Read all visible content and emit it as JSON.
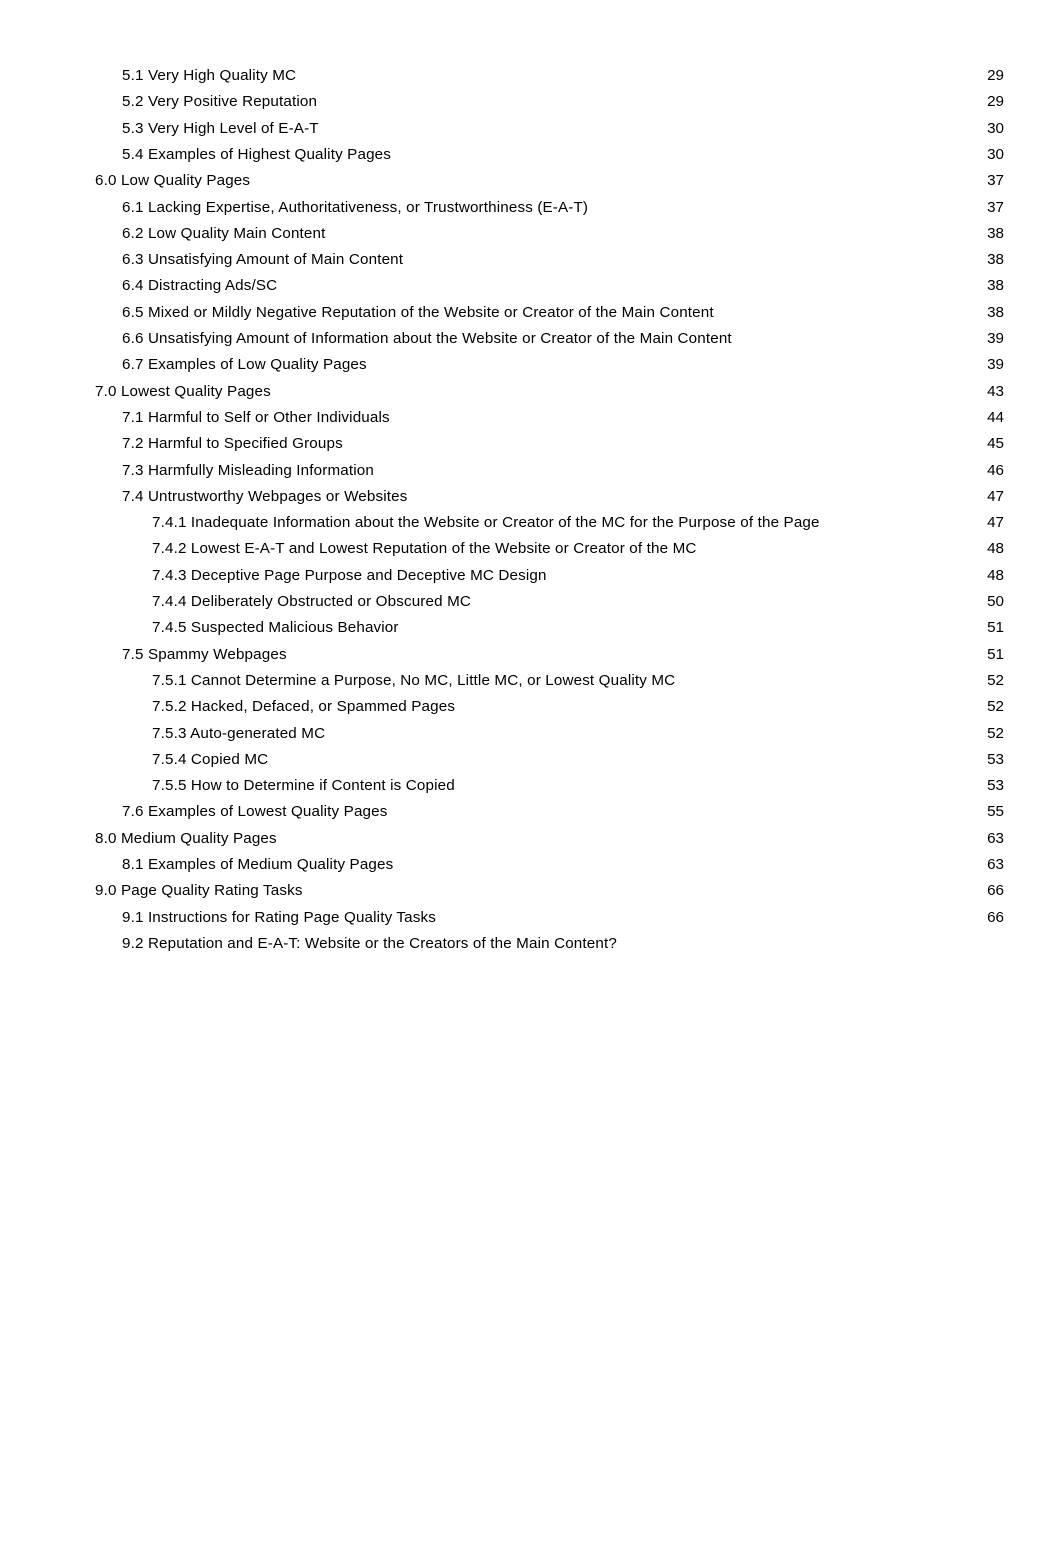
{
  "document": {
    "type": "table-of-contents",
    "page_background": "#ffffff",
    "text_color": "#000000"
  },
  "toc": {
    "entries": [
      {
        "label": "5.1 Very High Quality MC",
        "page": "29",
        "level": 2,
        "blur": 0
      },
      {
        "label": "5.2 Very Positive Reputation",
        "page": "29",
        "level": 2,
        "blur": 0
      },
      {
        "label": "5.3 Very High Level of E-A-T",
        "page": "30",
        "level": 2,
        "blur": 0
      },
      {
        "label": "5.4 Examples of Highest Quality Pages",
        "page": "30",
        "level": 2,
        "blur": 0
      },
      {
        "label": "6.0 Low Quality Pages",
        "page": "37",
        "level": 1,
        "blur": 0
      },
      {
        "label": "6.1 Lacking Expertise, Authoritativeness, or Trustworthiness (E-A-T)",
        "page": "37",
        "level": 2,
        "blur": 0
      },
      {
        "label": "6.2 Low Quality Main Content",
        "page": "38",
        "level": 2,
        "blur": 0
      },
      {
        "label": "6.3 Unsatisfying Amount of Main Content",
        "page": "38",
        "level": 2,
        "blur": 0
      },
      {
        "label": "6.4 Distracting Ads/SC",
        "page": "38",
        "level": 2,
        "blur": 0
      },
      {
        "label": "6.5 Mixed or Mildly Negative Reputation of the Website or Creator of the Main Content",
        "page": "38",
        "level": 2,
        "blur": 0
      },
      {
        "label": "6.6 Unsatisfying Amount of Information about the Website or Creator of the Main Content",
        "page": "39",
        "level": 2,
        "blur": 0
      },
      {
        "label": "6.7 Examples of Low Quality Pages",
        "page": "39",
        "level": 2,
        "blur": 0
      },
      {
        "label": "7.0 Lowest Quality Pages",
        "page": "43",
        "level": 1,
        "blur": 0
      },
      {
        "label": "7.1 Harmful to Self or Other Individuals",
        "page": "44",
        "level": 2,
        "blur": 0
      },
      {
        "label": "7.2 Harmful to Specified Groups",
        "page": "45",
        "level": 2,
        "blur": 0
      },
      {
        "label": "7.3 Harmfully Misleading Information",
        "page": "46",
        "level": 2,
        "blur": 0
      },
      {
        "label": "7.4 Untrustworthy Webpages or Websites",
        "page": "47",
        "level": 2,
        "blur": 0
      },
      {
        "label": "7.4.1 Inadequate Information about the Website or Creator of the MC for the Purpose of the Page",
        "page": "47",
        "level": 3,
        "blur": 0
      },
      {
        "label": "7.4.2 Lowest E-A-T and Lowest Reputation of the Website or Creator of the MC",
        "page": "48",
        "level": 3,
        "blur": 0
      },
      {
        "label": "7.4.3 Deceptive Page Purpose and Deceptive MC Design",
        "page": "48",
        "level": 3,
        "blur": 0
      },
      {
        "label": "7.4.4 Deliberately Obstructed or Obscured MC",
        "page": "50",
        "level": 3,
        "blur": 0
      },
      {
        "label": "7.4.5 Suspected Malicious Behavior",
        "page": "51",
        "level": 3,
        "blur": 0
      },
      {
        "label": "7.5 Spammy Webpages",
        "page": "51",
        "level": 2,
        "blur": 0
      },
      {
        "label": "7.5.1 Cannot Determine a Purpose, No MC, Little MC, or Lowest Quality MC",
        "page": "52",
        "level": 3,
        "blur": 0
      },
      {
        "label": "7.5.2 Hacked, Defaced, or Spammed Pages",
        "page": "52",
        "level": 3,
        "blur": 0
      },
      {
        "label": "7.5.3 Auto-generated MC",
        "page": "52",
        "level": 3,
        "blur": 0
      },
      {
        "label": "7.5.4 Copied MC",
        "page": "53",
        "level": 3,
        "blur": 0
      },
      {
        "label": "7.5.5 How to Determine if Content is Copied",
        "page": "53",
        "level": 3,
        "blur": 0
      },
      {
        "label": "7.6 Examples of Lowest Quality Pages",
        "page": "55",
        "level": 2,
        "blur": 0
      },
      {
        "label": "8.0 Medium Quality Pages",
        "page": "63",
        "level": 1,
        "blur": 0
      },
      {
        "label": "8.1 Examples of Medium Quality Pages",
        "page": "63",
        "level": 2,
        "blur": 0
      },
      {
        "label": "9.0 Page Quality Rating Tasks",
        "page": "66",
        "level": 1,
        "blur": 0
      },
      {
        "label": "9.1 Instructions for Rating Page Quality Tasks",
        "page": "66",
        "level": 2,
        "blur": 0
      },
      {
        "label": "9.2 Reputation and E-A-T: Website or the Creators of the Main Content?",
        "page": "",
        "level": 2,
        "blur": 0
      },
      {
        "label": "",
        "page": "",
        "level": 1,
        "blur": 1
      },
      {
        "label": "",
        "page": "",
        "level": 2,
        "blur": 2
      },
      {
        "label": "",
        "page": "",
        "level": 2,
        "blur": 2
      },
      {
        "label": "",
        "page": "",
        "level": 2,
        "blur": 3
      },
      {
        "label": "",
        "page": "",
        "level": 1,
        "blur": 3
      },
      {
        "label": "",
        "page": "",
        "level": 2,
        "blur": 4
      },
      {
        "label": "",
        "page": "",
        "level": 0,
        "blur": 4
      },
      {
        "label": "",
        "page": "",
        "level": 1,
        "blur": 5
      },
      {
        "label": "",
        "page": "",
        "level": 2,
        "blur": 5
      },
      {
        "label": "",
        "page": "",
        "level": 2,
        "blur": 6
      },
      {
        "label": "",
        "page": "",
        "level": 2,
        "blur": 6
      },
      {
        "label": "",
        "page": "",
        "level": 2,
        "blur": 7
      }
    ]
  },
  "footer": {
    "center_text": "",
    "page_number": ""
  }
}
